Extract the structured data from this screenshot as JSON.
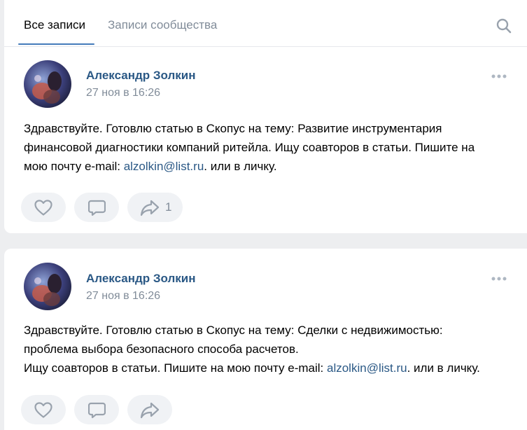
{
  "tabs": {
    "all_posts": "Все записи",
    "community_posts": "Записи сообщества"
  },
  "posts": [
    {
      "author": "Александр Золкин",
      "date": "27 ноя в 16:26",
      "text_line1": "Здравствуйте. Готовлю статью в Скопус на тему: Развитие инструментария",
      "text_line2": "финансовой диагностики компаний ритейла. Ищу соавторов в статьи. Пишите на",
      "text_line3_before": "мою почту e-mail: ",
      "email": "alzolkin@list.ru",
      "text_line3_after": ". или в личку.",
      "share_count": "1"
    },
    {
      "author": "Александр Золкин",
      "date": "27 ноя в 16:26",
      "text_line1": "Здравствуйте. Готовлю статью в Скопус на тему: Сделки с недвижимостью:",
      "text_line2": "проблема выбора безопасного способа расчетов.",
      "text_line3_before": "Ищу соавторов в статьи. Пишите на мою почту e-mail: ",
      "email": "alzolkin@list.ru",
      "text_line3_after": ". или в личку.",
      "share_count": ""
    }
  ],
  "icons": {
    "search": "search-icon",
    "more": "more-dots-icon",
    "like": "heart-icon",
    "comment": "comment-icon",
    "share": "share-arrow-icon"
  },
  "colors": {
    "link": "#2a5885",
    "accent": "#447bba",
    "muted": "#818c99",
    "background": "#edeef0"
  }
}
